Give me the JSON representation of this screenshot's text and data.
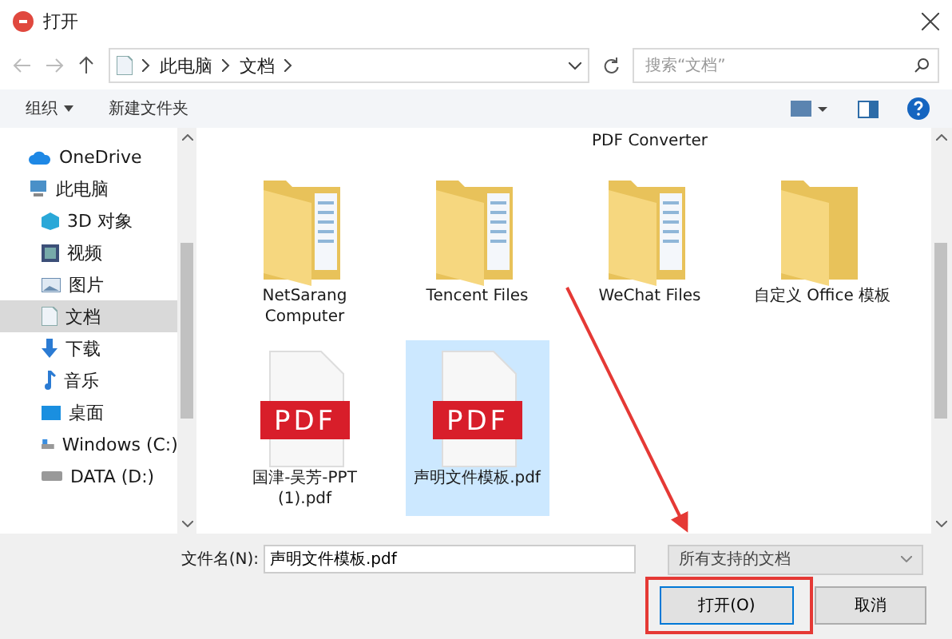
{
  "window": {
    "title": "打开"
  },
  "address": {
    "path": [
      "此电脑",
      "文档"
    ]
  },
  "search": {
    "placeholder": "搜索“文档”"
  },
  "toolbar": {
    "organize": "组织",
    "new_folder": "新建文件夹"
  },
  "sidebar": {
    "items": [
      {
        "label": "OneDrive",
        "kind": "cloud",
        "selected": false
      },
      {
        "label": "此电脑",
        "kind": "pc",
        "selected": false,
        "children": [
          {
            "label": "3D 对象",
            "kind": "cube",
            "selected": false
          },
          {
            "label": "视频",
            "kind": "video",
            "selected": false
          },
          {
            "label": "图片",
            "kind": "picture",
            "selected": false
          },
          {
            "label": "文档",
            "kind": "document",
            "selected": true
          },
          {
            "label": "下载",
            "kind": "download",
            "selected": false
          },
          {
            "label": "音乐",
            "kind": "music",
            "selected": false
          },
          {
            "label": "桌面",
            "kind": "desktop",
            "selected": false
          },
          {
            "label": "Windows (C:)",
            "kind": "drive",
            "selected": false
          },
          {
            "label": "DATA (D:)",
            "kind": "disk",
            "selected": false
          }
        ]
      }
    ]
  },
  "files": [
    {
      "kind": "cut"
    },
    {
      "kind": "cut"
    },
    {
      "kind": "cut",
      "label": "PDF Converter"
    },
    {
      "kind": "cut"
    },
    {
      "kind": "folder",
      "label": "NetSarang Computer",
      "selected": false
    },
    {
      "kind": "folder",
      "label": "Tencent Files",
      "selected": false
    },
    {
      "kind": "folder",
      "label": "WeChat Files",
      "selected": false
    },
    {
      "kind": "plain-folder",
      "label": "自定义 Office 模板",
      "selected": false
    },
    {
      "kind": "pdf",
      "label": "国津-吴芳-PPT (1).pdf",
      "badge": "PDF",
      "selected": false
    },
    {
      "kind": "pdf",
      "label": "声明文件模板.pdf",
      "badge": "PDF",
      "selected": true
    }
  ],
  "footer": {
    "filename_label": "文件名(N):",
    "filename": "声明文件模板.pdf",
    "filetype": "所有支持的文档",
    "open": "打开(O)",
    "cancel": "取消"
  }
}
